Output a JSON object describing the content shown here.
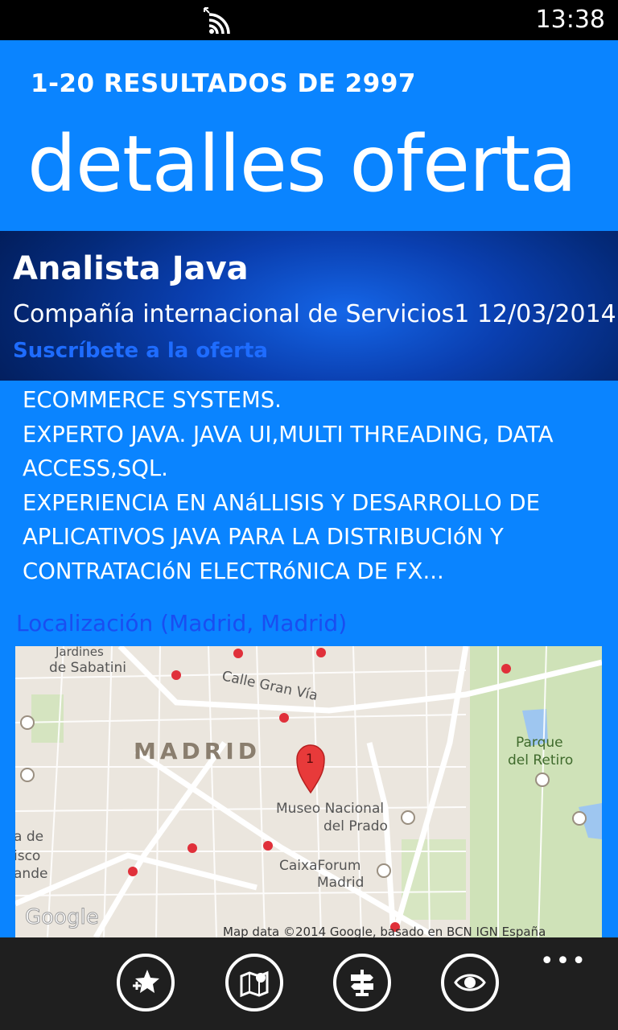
{
  "status_bar": {
    "time": "13:38",
    "signal_icon": "wifi-signal-icon"
  },
  "header": {
    "results": "1-20 RESULTADOS DE 2997",
    "title": "detalles oferta"
  },
  "job": {
    "title": "Analista Java",
    "company_date": "Compañía internacional de Servicios1 12/03/2014",
    "subscribe_link": "Suscríbete a la oferta"
  },
  "description": [
    "ECOMMERCE SYSTEMS.",
    "EXPERTO JAVA. JAVA UI,MULTI THREADING, DATA",
    "ACCESS,SQL.",
    "EXPERIENCIA EN ANáLLISIS Y DESARROLLO DE",
    "APLICATIVOS JAVA PARA LA DISTRIBUCIóN Y",
    "CONTRATACIóN ELECTRóNICA DE FX..."
  ],
  "location_label": "Localización (Madrid, Madrid)",
  "map": {
    "labels": {
      "jardines": "Jardines",
      "sabatini": "de Sabatini",
      "gran_via": "Calle Gran Vía",
      "madrid": "MADRID",
      "museo1": "Museo Nacional",
      "museo2": "del Prado",
      "caixa1": "CaixaForum",
      "caixa2": "Madrid",
      "parque1": "Parque",
      "parque2": "del Retiro",
      "left1": "a de",
      "left2": "isco",
      "left3": "ande",
      "google": "Google",
      "attribution": "Map data ©2014 Google, basado en BCN IGN España"
    },
    "pin_label": "1"
  },
  "app_bar": {
    "buttons": [
      {
        "icon": "add-favorite-icon"
      },
      {
        "icon": "map-icon"
      },
      {
        "icon": "directions-icon"
      },
      {
        "icon": "eye-icon"
      }
    ],
    "more": "•••"
  },
  "colors": {
    "accent": "#0a84ff",
    "link": "#1e6cff",
    "appbar": "#1f1f1f"
  }
}
